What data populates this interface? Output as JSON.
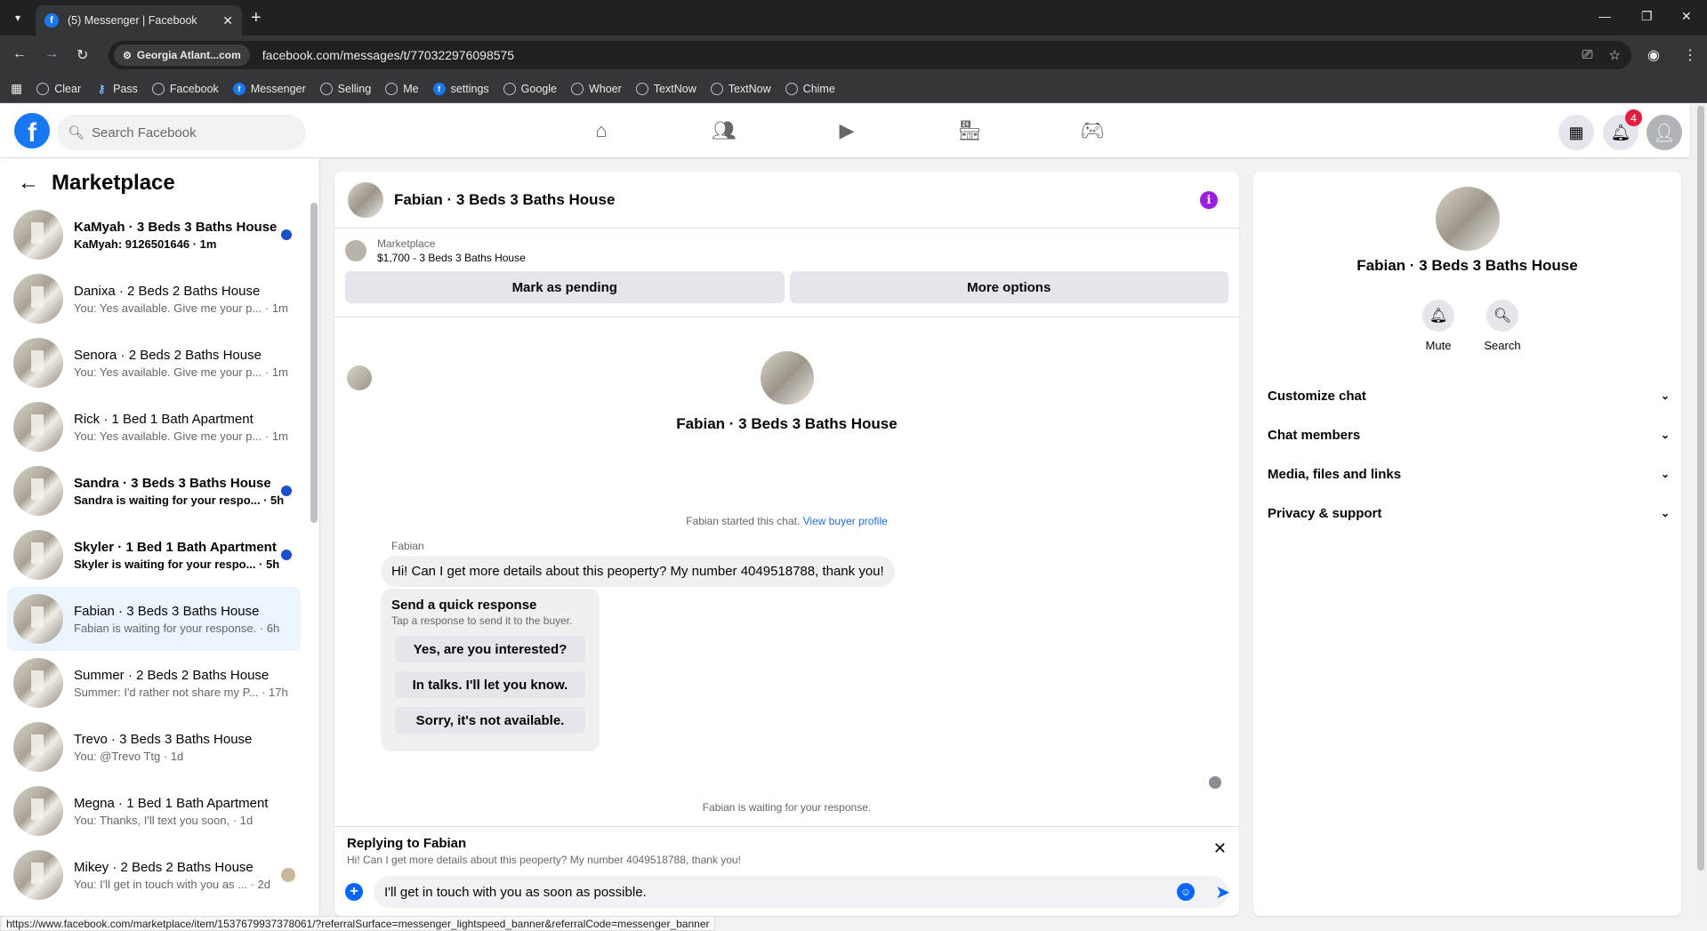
{
  "browser": {
    "tab_title": "(5) Messenger | Facebook",
    "site_chip": "Georgia Atlant...com",
    "url": "facebook.com/messages/t/770322976098575",
    "bookmarks": [
      {
        "label": "Clear",
        "icon": "globe-icon"
      },
      {
        "label": "Pass",
        "icon": "key-icon"
      },
      {
        "label": "Facebook",
        "icon": "globe-icon"
      },
      {
        "label": "Messenger",
        "icon": "facebook-icon"
      },
      {
        "label": "Selling",
        "icon": "globe-icon"
      },
      {
        "label": "Me",
        "icon": "globe-icon"
      },
      {
        "label": "settings",
        "icon": "facebook-icon"
      },
      {
        "label": "Google",
        "icon": "globe-icon"
      },
      {
        "label": "Whoer",
        "icon": "globe-icon"
      },
      {
        "label": "TextNow",
        "icon": "globe-icon"
      },
      {
        "label": "TextNow",
        "icon": "globe-icon"
      },
      {
        "label": "Chime",
        "icon": "globe-icon"
      }
    ]
  },
  "header": {
    "search_placeholder": "Search Facebook",
    "notification_count": "4",
    "brand_color": "#1877f2"
  },
  "sidebar": {
    "title": "Marketplace",
    "conversations": [
      {
        "name": "KaMyah · 3 Beds 3 Baths House",
        "preview": "KaMyah: 9126501646 · 1m",
        "unread": true
      },
      {
        "name": "Danixa · 2 Beds 2 Baths House",
        "preview": "You: Yes available. Give me your p... · 1m",
        "unread": false
      },
      {
        "name": "Senora · 2 Beds 2 Baths House",
        "preview": "You: Yes available. Give me your p... · 1m",
        "unread": false
      },
      {
        "name": "Rick · 1 Bed 1 Bath Apartment",
        "preview": "You: Yes available. Give me your p... · 1m",
        "unread": false
      },
      {
        "name": "Sandra · 3 Beds 3 Baths House",
        "preview": "Sandra is waiting for your respo... · 5h",
        "unread": true
      },
      {
        "name": "Skyler · 1 Bed 1 Bath Apartment",
        "preview": "Skyler is waiting for your respo... · 5h",
        "unread": true
      },
      {
        "name": "Fabian · 3 Beds 3 Baths House",
        "preview": "Fabian is waiting for your response. · 6h",
        "unread": false,
        "active": true
      },
      {
        "name": "Summer · 2 Beds 2 Baths House",
        "preview": "Summer: I'd rather not share my P... · 17h",
        "unread": false
      },
      {
        "name": "Trevo · 3 Beds 3 Baths House",
        "preview": "You: @Trevo Ttg · 1d",
        "unread": false
      },
      {
        "name": "Megna · 1 Bed 1 Bath Apartment",
        "preview": "You: Thanks, I'll text you soon, · 1d",
        "unread": false
      },
      {
        "name": "Mikey · 2 Beds 2 Baths House",
        "preview": "You: I'll get in touch with you as ... · 2d",
        "unread": false
      }
    ]
  },
  "chat": {
    "title": "Fabian · 3 Beds 3 Baths House",
    "marketplace_label": "Marketplace",
    "listing": "$1,700 - 3 Beds 3 Baths House",
    "mark_pending": "Mark as pending",
    "more_options": "More options",
    "intro_name": "Fabian · 3 Beds 3 Baths House",
    "started_text": "Fabian started this chat.",
    "view_profile": "View buyer profile",
    "sender": "Fabian",
    "message": "Hi! Can I get more details about this peoperty? My number 4049518788, thank you!",
    "quick_title": "Send a quick response",
    "quick_sub": "Tap a response to send it to the buyer.",
    "quick_responses": [
      "Yes, are you interested?",
      "In talks. I'll let you know.",
      "Sorry, it's not available."
    ],
    "waiting": "Fabian is waiting for your response.",
    "reply_title": "Replying to Fabian",
    "reply_text": "Hi! Can I get more details about this peoperty? My number 4049518788, thank you!",
    "compose_value": "I'll get in touch with you as soon as possible."
  },
  "details": {
    "name": "Fabian · 3 Beds 3 Baths House",
    "mute_label": "Mute",
    "search_label": "Search",
    "sections": [
      "Customize chat",
      "Chat members",
      "Media, files and links",
      "Privacy & support"
    ]
  },
  "status_url": "https://www.facebook.com/marketplace/item/1537679937378061/?referralSurface=messenger_lightspeed_banner&referralCode=messenger_banner"
}
